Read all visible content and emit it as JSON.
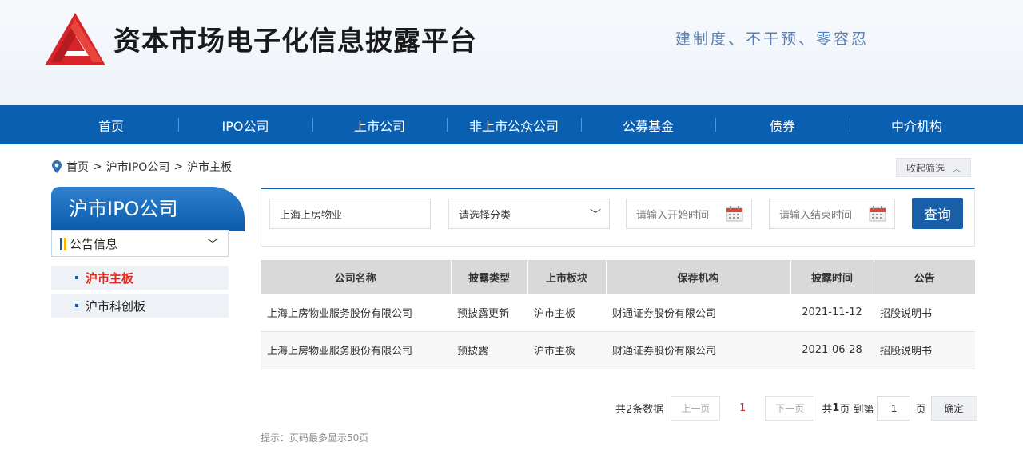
{
  "header": {
    "site_title": "资本市场电子化信息披露平台",
    "slogan": "建制度、不干预、零容忍"
  },
  "nav": [
    {
      "label": "首页"
    },
    {
      "label": "IPO公司"
    },
    {
      "label": "上市公司"
    },
    {
      "label": "非上市公众公司"
    },
    {
      "label": "公募基金"
    },
    {
      "label": "债券"
    },
    {
      "label": "中介机构"
    }
  ],
  "breadcrumb": {
    "home": "首页",
    "sep1": ">",
    "level1": "沪市IPO公司",
    "sep2": ">",
    "level2": "沪市主板"
  },
  "collapse": {
    "label": "收起筛选",
    "icon": "chevron-up-icon"
  },
  "sidebar": {
    "title": "沪市IPO公司",
    "section": "公告信息",
    "items": [
      {
        "label": "沪市主板",
        "active": true
      },
      {
        "label": "沪市科创板",
        "active": false
      }
    ]
  },
  "filter": {
    "company_value": "上海上房物业",
    "category_value": "请选择分类",
    "start_placeholder": "请输入开始时间",
    "end_placeholder": "请输入结束时间",
    "query_label": "查询"
  },
  "table": {
    "headers": [
      "公司名称",
      "披露类型",
      "上市板块",
      "保荐机构",
      "披露时间",
      "公告"
    ],
    "rows": [
      [
        "上海上房物业服务股份有限公司",
        "预披露更新",
        "沪市主板",
        "财通证券股份有限公司",
        "2021-11-12",
        "招股说明书"
      ],
      [
        "上海上房物业服务股份有限公司",
        "预披露",
        "沪市主板",
        "财通证券股份有限公司",
        "2021-06-28",
        "招股说明书"
      ]
    ]
  },
  "pager": {
    "total": "共2条数据",
    "prev": "上一页",
    "current": "1",
    "next": "下一页",
    "pages_prefix": "共",
    "pages_count": "1",
    "pages_suffix": "页 到第",
    "goto_value": "1",
    "goto_suffix": "页",
    "ok": "确定"
  },
  "hint": "提示：页码最多显示50页",
  "colors": {
    "brand": "#0a5fb1",
    "accent_red": "#e8261a",
    "logo_red": "#d8232a"
  }
}
